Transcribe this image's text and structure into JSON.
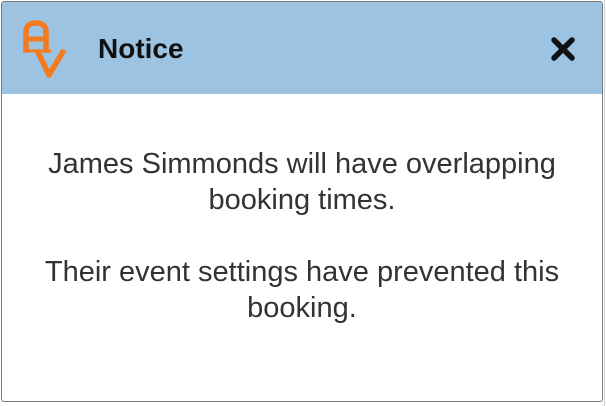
{
  "dialog": {
    "title": "Notice",
    "logo_icon": "av-logo-icon",
    "close_icon": "close-icon",
    "messages": [
      "James Simmonds will have overlapping booking times.",
      "Their event settings have prevented this booking."
    ]
  },
  "colors": {
    "header_background": "#9dc3e3",
    "logo_orange": "#f47a20",
    "text": "#333333"
  }
}
